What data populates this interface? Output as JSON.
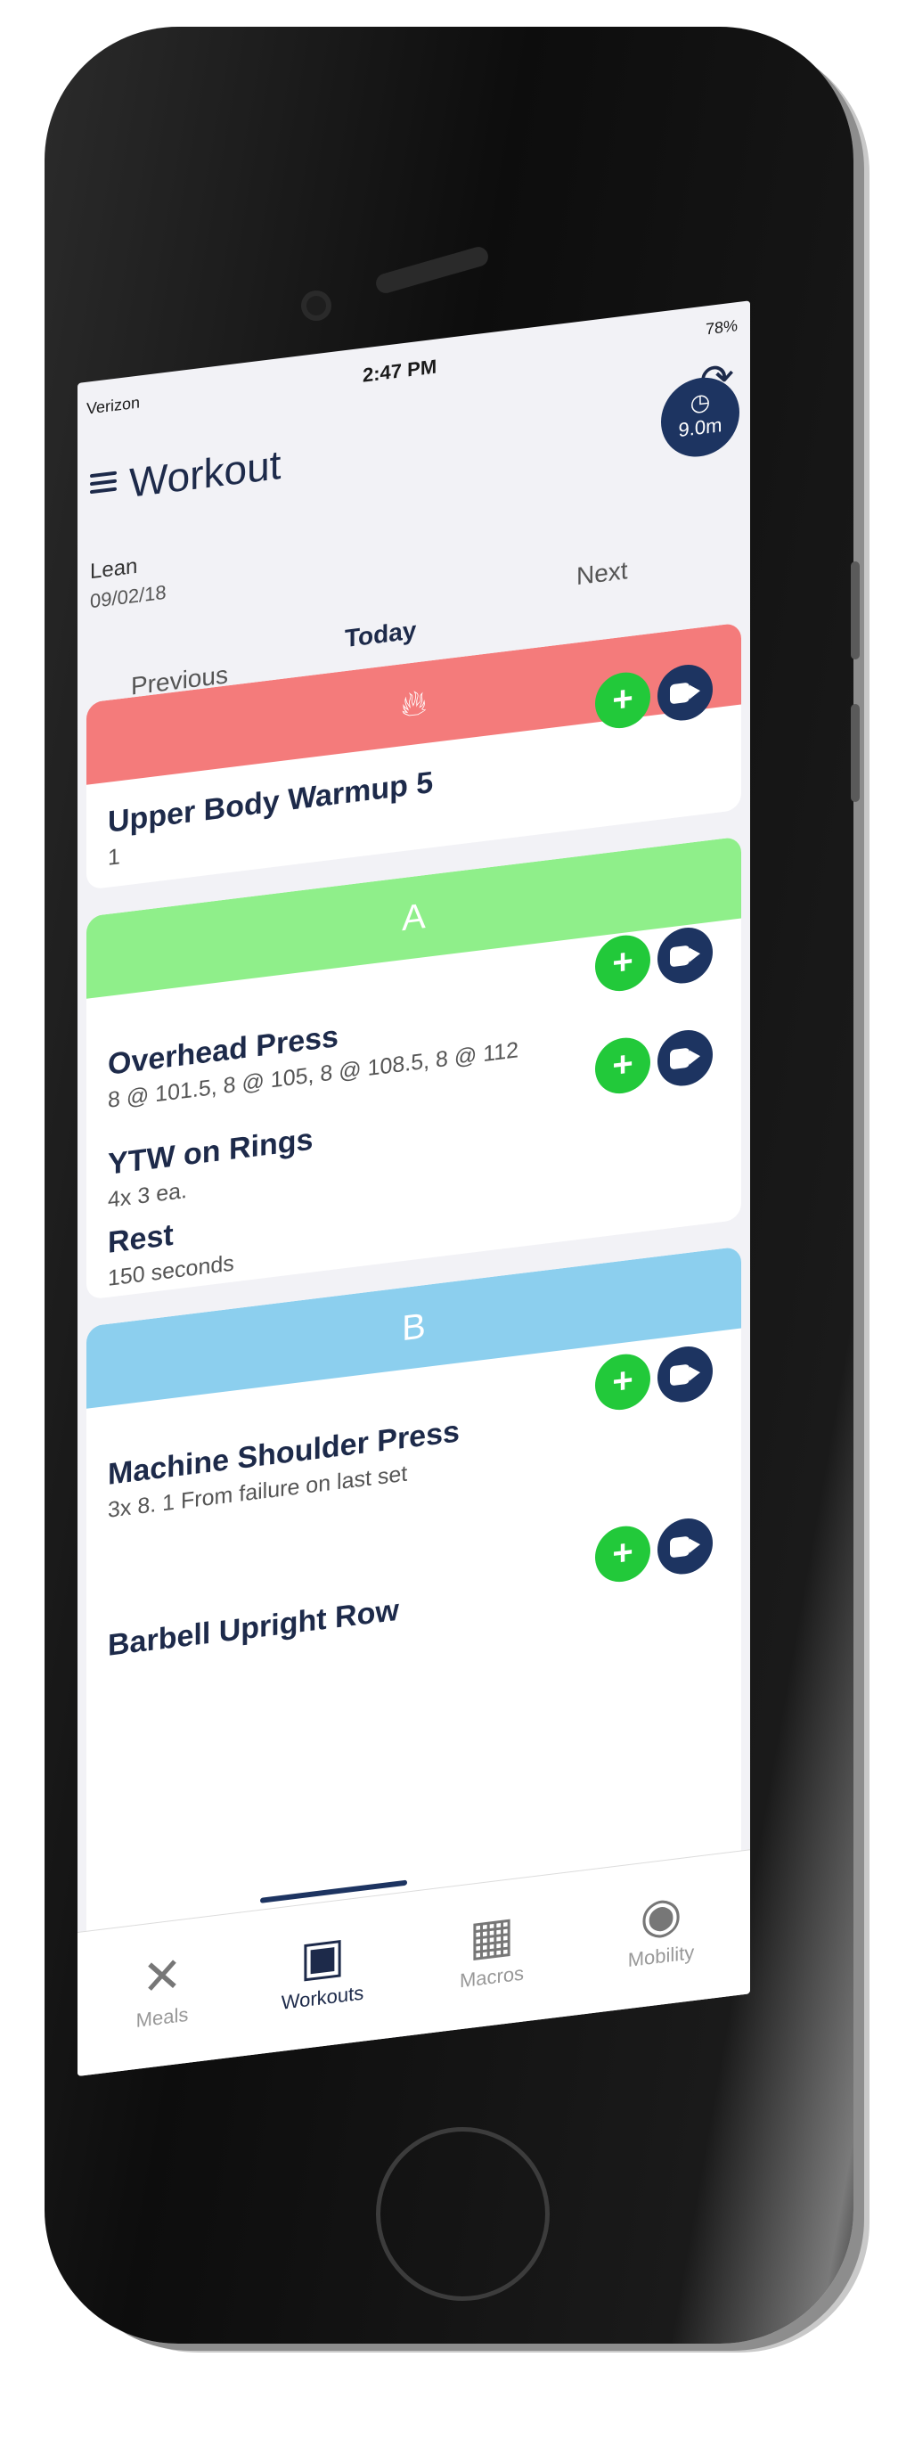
{
  "status_bar": {
    "carrier": "Verizon",
    "time": "2:47 PM",
    "battery": "78%"
  },
  "header": {
    "title": "Workout",
    "timer": "9.0m"
  },
  "plan": {
    "name": "Lean",
    "date": "09/02/18"
  },
  "tabs": {
    "previous": "Previous",
    "today": "Today",
    "next": "Next"
  },
  "sections": [
    {
      "label": "",
      "color": "#f47b7b",
      "exercises": [
        {
          "name": "Upper Body Warmup 5",
          "detail": "1"
        }
      ]
    },
    {
      "label": "A",
      "color": "#8fef8a",
      "exercises": [
        {
          "name": "Overhead Press",
          "detail": "8 @ 101.5, 8 @ 105, 8 @ 108.5, 8 @ 112"
        },
        {
          "name": "YTW on Rings",
          "detail": "4x 3 ea."
        },
        {
          "name": "Rest",
          "detail": "150 seconds"
        }
      ]
    },
    {
      "label": "B",
      "color": "#8ccfee",
      "exercises": [
        {
          "name": "Machine Shoulder Press",
          "detail": "3x 8. 1 From failure on last set"
        },
        {
          "name": "Barbell Upright Row",
          "detail": ""
        }
      ]
    }
  ],
  "bottom_nav": [
    {
      "label": "Meals",
      "icon": "fork-knife-icon"
    },
    {
      "label": "Workouts",
      "icon": "calendar-icon"
    },
    {
      "label": "Macros",
      "icon": "calculator-icon"
    },
    {
      "label": "Mobility",
      "icon": "person-icon"
    }
  ],
  "colors": {
    "primary": "#1d3461",
    "add": "#22c93a"
  }
}
